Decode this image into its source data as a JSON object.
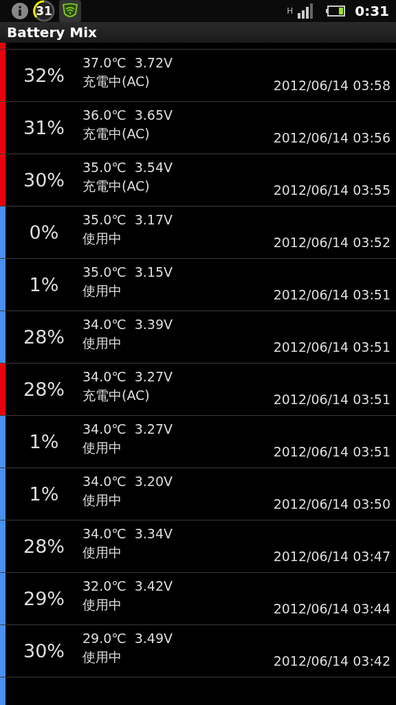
{
  "status_bar": {
    "badge": "31",
    "network": "H",
    "time": "0:31"
  },
  "app_bar": {
    "title": "Battery Mix"
  },
  "cut_top": {
    "color": "#e8000b"
  },
  "rows": [
    {
      "percent": "32%",
      "reading": "37.0℃  3.72V",
      "state": "充電中(AC)",
      "time": "2012/06/14 03:58",
      "color": "#e8000b"
    },
    {
      "percent": "31%",
      "reading": "36.0℃  3.65V",
      "state": "充電中(AC)",
      "time": "2012/06/14 03:56",
      "color": "#e8000b"
    },
    {
      "percent": "30%",
      "reading": "35.0℃  3.54V",
      "state": "充電中(AC)",
      "time": "2012/06/14 03:55",
      "color": "#e8000b"
    },
    {
      "percent": "0%",
      "reading": "35.0℃  3.17V",
      "state": "使用中",
      "time": "2012/06/14 03:52",
      "color": "#4a90f0"
    },
    {
      "percent": "1%",
      "reading": "35.0℃  3.15V",
      "state": "使用中",
      "time": "2012/06/14 03:51",
      "color": "#4a90f0"
    },
    {
      "percent": "28%",
      "reading": "34.0℃  3.39V",
      "state": "使用中",
      "time": "2012/06/14 03:51",
      "color": "#4a90f0"
    },
    {
      "percent": "28%",
      "reading": "34.0℃  3.27V",
      "state": "充電中(AC)",
      "time": "2012/06/14 03:51",
      "color": "#e8000b"
    },
    {
      "percent": "1%",
      "reading": "34.0℃  3.27V",
      "state": "使用中",
      "time": "2012/06/14 03:51",
      "color": "#4a90f0"
    },
    {
      "percent": "1%",
      "reading": "34.0℃  3.20V",
      "state": "使用中",
      "time": "2012/06/14 03:50",
      "color": "#4a90f0"
    },
    {
      "percent": "28%",
      "reading": "34.0℃  3.34V",
      "state": "使用中",
      "time": "2012/06/14 03:47",
      "color": "#4a90f0"
    },
    {
      "percent": "29%",
      "reading": "32.0℃  3.42V",
      "state": "使用中",
      "time": "2012/06/14 03:44",
      "color": "#4a90f0"
    },
    {
      "percent": "30%",
      "reading": "29.0℃  3.49V",
      "state": "使用中",
      "time": "2012/06/14 03:42",
      "color": "#4a90f0"
    }
  ],
  "cut_bottom": {
    "color": "#4a90f0"
  }
}
